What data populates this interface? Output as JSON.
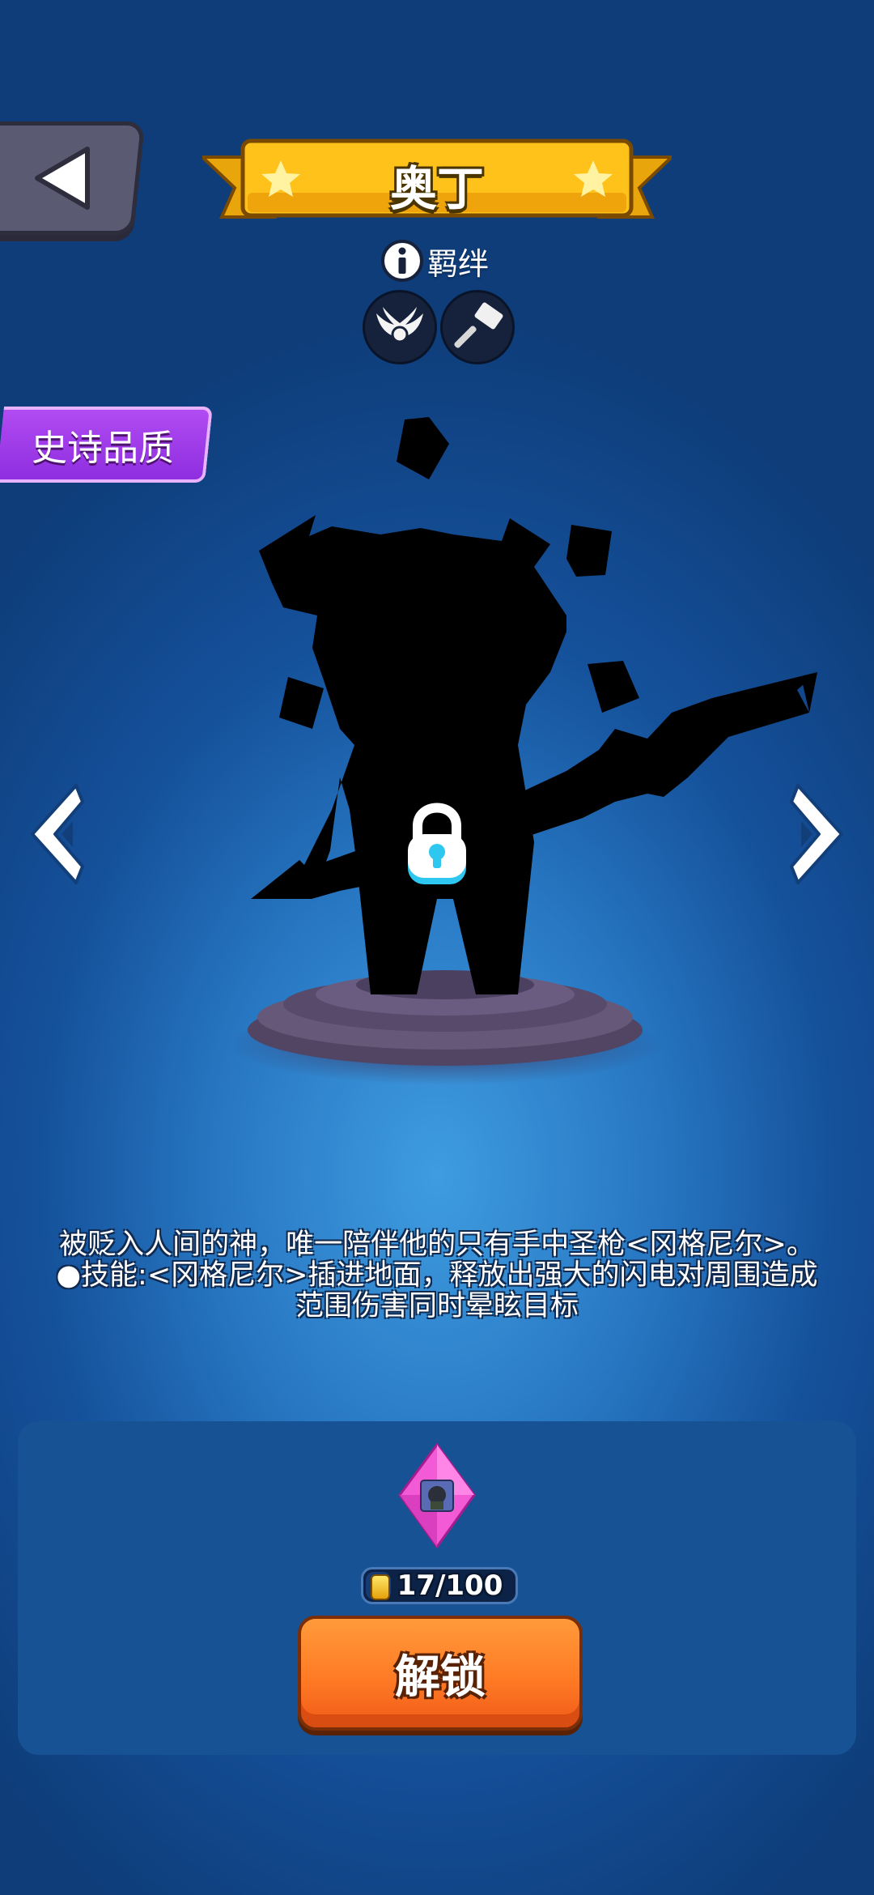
{
  "hero": {
    "name": "奥丁",
    "quality": "史诗品质",
    "locked": true
  },
  "bond": {
    "label": "羁绊",
    "icons": [
      "winged-emblem-icon",
      "hammer-icon"
    ]
  },
  "description": {
    "lines": [
      "被贬入人间的神，唯一陪伴他的只有手中圣枪<冈格尼尔>。",
      "●技能:<冈格尼尔>插进地面，释放出强大的闪电对周围造成",
      "范围伤害同时晕眩目标"
    ]
  },
  "unlock": {
    "progress_text": "17/100",
    "progress_current": 17,
    "progress_max": 100,
    "button_label": "解锁"
  },
  "colors": {
    "banner": "#ffc21a",
    "quality": "#a53fe8",
    "unlock_button": "#ff7b25",
    "panel": "#175294"
  }
}
